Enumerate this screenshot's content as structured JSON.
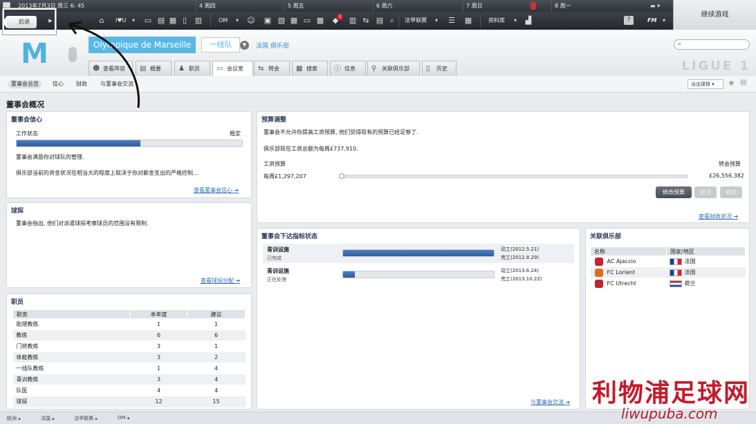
{
  "datebar": {
    "current": "2013年7月3日  周三  6: 45",
    "days": [
      "4 周四",
      "5 周五",
      "6 周六",
      "7 周日",
      "8 周一"
    ]
  },
  "toolbar": {
    "back_label": "后退",
    "team_code": "I♥U",
    "club_code": "OM",
    "league_label": "法甲联赛",
    "database_label": "资料库",
    "help_label": "?",
    "fm_label": "FM",
    "news_count": "1"
  },
  "continue_label": "继续游戏",
  "header": {
    "club_name": "Olympique de Marseille",
    "team": "一线队",
    "subtitle": "法国 俱乐部",
    "crest_text": "M",
    "ligue_text": "LIGUE 1"
  },
  "tabs": [
    "查看阵容",
    "概要",
    "职员",
    "会议室",
    "转会",
    "搜索",
    "信息",
    "关联俱乐部",
    "历史"
  ],
  "subnav": [
    "董事会总览",
    "信心",
    "财政",
    "与董事会交流"
  ],
  "scout_button": "派出球探",
  "page_title": "董事会概况",
  "confidence": {
    "title": "董事会信心",
    "label": "工作状态",
    "status": "稳定",
    "level": 0.55,
    "line1": "董事会满意你对球队的管理.",
    "line2": "俱乐部当前的资金状况在相当大的程度上取决于你对薪金支出的严格控制...",
    "link": "查看董事会信心 ➜"
  },
  "scouting": {
    "title": "球探",
    "text": "董事会指出, 他们对派遣球探考察球员的范围没有限制.",
    "link": "查看球探分配 ➜"
  },
  "staff": {
    "title": "职员",
    "columns": [
      "职务",
      "本年度",
      "建议"
    ],
    "rows": [
      [
        "助理教练",
        "1",
        "1"
      ],
      [
        "教练",
        "6",
        "6"
      ],
      [
        "门将教练",
        "3",
        "1"
      ],
      [
        "体能教练",
        "3",
        "2"
      ],
      [
        "一线队教练",
        "1",
        "4"
      ],
      [
        "青训教练",
        "3",
        "4"
      ],
      [
        "队医",
        "4",
        "4"
      ],
      [
        "球探",
        "12",
        "15"
      ]
    ]
  },
  "budget": {
    "title": "预算调整",
    "line1": "董事会不允许你提高工资预算, 他们觉得现有的预算已经足够了.",
    "line2": "俱乐部现在工资总额为每周£737,910.",
    "wage_label": "工资预算",
    "transfer_label": "转会预算",
    "wage_value": "每周£1,297,207",
    "transfer_value": "£26,556,382",
    "buttons": [
      "修改预算",
      "取消",
      "确定"
    ],
    "link": "查看财政状况 ➜"
  },
  "requests": {
    "title": "董事会下达指标状态",
    "items": [
      {
        "name": "青训设施",
        "state": "已完成",
        "progress": 1.0,
        "start": "动工(2012.5.21)",
        "end": "完工(2012.8.29)"
      },
      {
        "name": "青训设施",
        "state": "正在处理",
        "progress": 0.08,
        "start": "动工(2013.6.24)",
        "end": "完工(2013.10.22)"
      }
    ],
    "link": "与董事会交流 ➜"
  },
  "affiliates": {
    "title": "关联俱乐部",
    "columns": [
      "名称",
      "国家/地区"
    ],
    "rows": [
      {
        "name": "AC Ajaccio",
        "country": "法国",
        "flag": "fr",
        "crest_color": "#c8202f"
      },
      {
        "name": "FC Lorient",
        "country": "法国",
        "flag": "fr",
        "crest_color": "#e06a1f"
      },
      {
        "name": "FC Utrecht",
        "country": "荷兰",
        "flag": "nl",
        "crest_color": "#c0242d"
      }
    ]
  },
  "footer": [
    "欧洲",
    "法国",
    "法甲联赛",
    "OM"
  ],
  "watermark": {
    "big": "利物浦足球网",
    "small": "liwupuba.com"
  }
}
